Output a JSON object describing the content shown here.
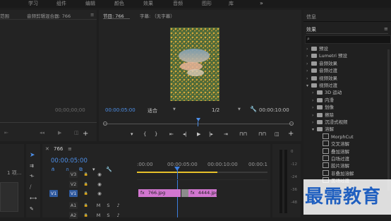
{
  "menu": {
    "items": [
      "学习",
      "组件",
      "编辑",
      "颜色",
      "效果",
      "音频",
      "图形",
      "库"
    ]
  },
  "source_panel": {
    "tab_left": "范围",
    "tab_mixer": "音频剪辑混合器: 766",
    "menu_glyph": "≡",
    "timecode": "00;00;00;00"
  },
  "program_panel": {
    "tab_program": "节目: 766",
    "tab_caption": "字幕: （无字幕）",
    "timecode_current": "00:00:05:00",
    "fit": "适合",
    "resolution": "1/2",
    "timecode_duration": "00:00:10:00"
  },
  "info_panel": {
    "title": "信息"
  },
  "effects_panel": {
    "title": "效果",
    "search_placeholder": "",
    "items": [
      {
        "label": "预设",
        "level": 0,
        "type": "folder",
        "expanded": false
      },
      {
        "label": "Lumetri 预设",
        "level": 0,
        "type": "folder",
        "expanded": false
      },
      {
        "label": "音频效果",
        "level": 0,
        "type": "folder",
        "expanded": false
      },
      {
        "label": "音频过渡",
        "level": 0,
        "type": "folder",
        "expanded": false
      },
      {
        "label": "视频效果",
        "level": 0,
        "type": "folder",
        "expanded": false
      },
      {
        "label": "视频过渡",
        "level": 0,
        "type": "folder",
        "expanded": true
      },
      {
        "label": "3D 运动",
        "level": 1,
        "type": "folder",
        "expanded": false
      },
      {
        "label": "内滑",
        "level": 1,
        "type": "folder",
        "expanded": false
      },
      {
        "label": "划像",
        "level": 1,
        "type": "folder",
        "expanded": false
      },
      {
        "label": "擦除",
        "level": 1,
        "type": "folder",
        "expanded": false
      },
      {
        "label": "沉浸式视频",
        "level": 1,
        "type": "folder",
        "expanded": false
      },
      {
        "label": "溶解",
        "level": 1,
        "type": "folder",
        "expanded": true
      },
      {
        "label": "MorphCut",
        "level": 2,
        "type": "effect"
      },
      {
        "label": "交叉溶解",
        "level": 2,
        "type": "effect"
      },
      {
        "label": "叠加溶解",
        "level": 2,
        "type": "effect"
      },
      {
        "label": "白场过渡",
        "level": 2,
        "type": "effect"
      },
      {
        "label": "胶片溶解",
        "level": 2,
        "type": "effect"
      },
      {
        "label": "非叠加溶解",
        "level": 2,
        "type": "effect"
      },
      {
        "label": "黑场过渡",
        "level": 2,
        "type": "effect"
      }
    ]
  },
  "project_panel": {
    "label": "1 项..."
  },
  "timeline": {
    "tab": "766",
    "timecode": "00:00:05:00",
    "ruler": [
      ":00:00",
      "00:00:05:00",
      "00:00:10:00",
      "00:00:1"
    ],
    "tracks": [
      {
        "src": "",
        "name": "V3",
        "lock": "🔒",
        "eye": "◉"
      },
      {
        "src": "",
        "name": "V2",
        "lock": "🔒",
        "eye": "◉"
      },
      {
        "src": "V1",
        "name": "V1",
        "lock": "🔒",
        "eye": "◉"
      },
      {
        "src": "",
        "name": "A1",
        "lock": "🔒",
        "m": "M",
        "s": "S"
      },
      {
        "src": "",
        "name": "A2",
        "lock": "🔒",
        "m": "M",
        "s": "S"
      }
    ],
    "clips": [
      {
        "label": "766.jpg",
        "fx": "fx"
      },
      {
        "label": "4444.jpg",
        "fx": "fx"
      }
    ],
    "meter_labels": [
      "0",
      "-12",
      "-24",
      "-36",
      "-48"
    ]
  },
  "watermark": "最需教育",
  "colors": {
    "accent": "#4d8fe8",
    "clip": "#d276d0",
    "playhead": "#3d7fe0",
    "workarea": "#e6c02a"
  }
}
